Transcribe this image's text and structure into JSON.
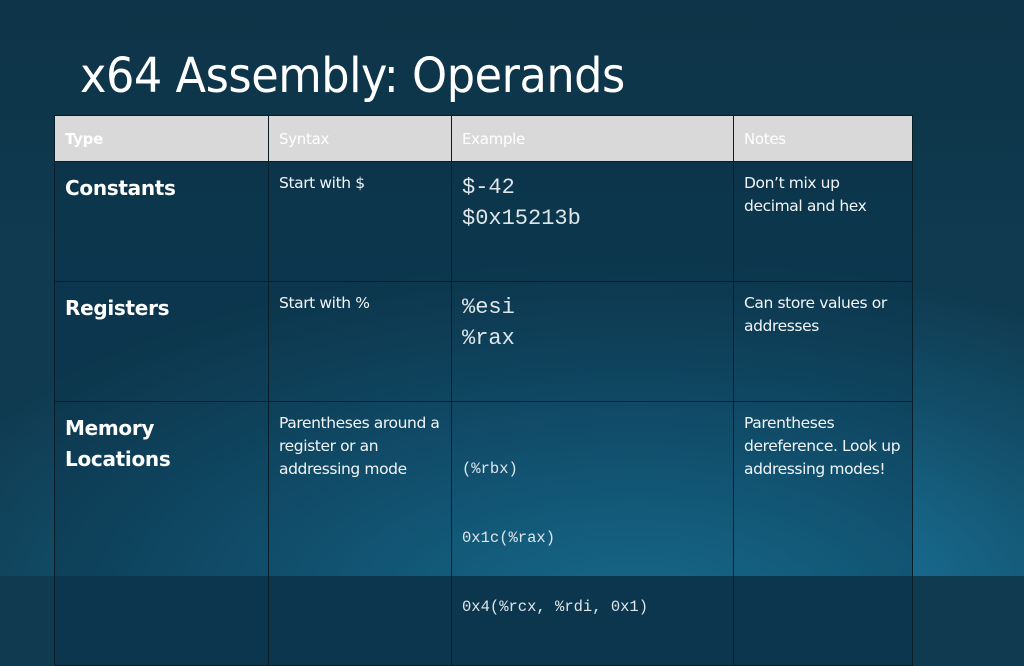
{
  "slide": {
    "title": "x64 Assembly: Operands",
    "colors": {
      "header_fill": "#d9d9d9",
      "background": "#15607f",
      "text": "#ffffff",
      "border": "#0a1e28"
    }
  },
  "table": {
    "headers": [
      "Type",
      "Syntax",
      "Example",
      "Notes"
    ],
    "rows": [
      {
        "type": "Constants",
        "syntax": "Start with $",
        "examples": [
          "$-42",
          "$0x15213b"
        ],
        "notes": "Don’t mix up decimal and hex"
      },
      {
        "type": "Registers",
        "syntax": "Start with %",
        "examples": [
          "%esi",
          "%rax"
        ],
        "notes": "Can store values or addresses"
      },
      {
        "type": "Memory Locations",
        "syntax": "Parentheses around a register or an addressing mode",
        "examples": [
          "(%rbx)",
          "0x1c(%rax)",
          "0x4(%rcx, %rdi, 0x1)"
        ],
        "notes": "Parentheses dereference. Look up addressing modes!"
      }
    ]
  }
}
